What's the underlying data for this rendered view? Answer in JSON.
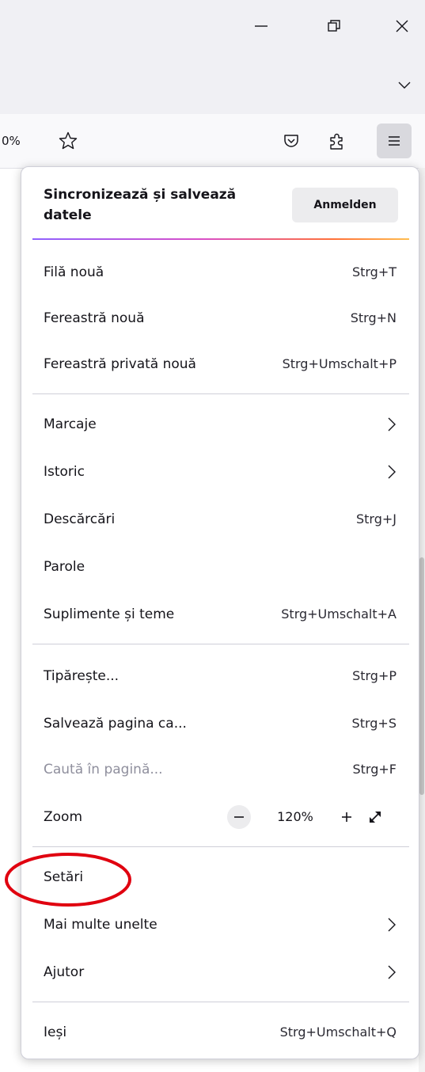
{
  "window": {
    "controls": {
      "minimize_icon": "minimize-icon",
      "restore_icon": "restore-icon",
      "close_icon": "close-icon"
    }
  },
  "tabstrip": {
    "list_tabs_icon": "chevron-down-icon"
  },
  "toolbar": {
    "url_fragment": "0%",
    "icons": [
      "star-icon",
      "pocket-icon",
      "extensions-icon",
      "hamburger-menu-icon"
    ]
  },
  "menu": {
    "sync": {
      "text": "Sincronizează și salvează datele",
      "signin_label": "Anmelden"
    },
    "group1": [
      {
        "label": "Filă nouă",
        "shortcut": "Strg+T"
      },
      {
        "label": "Fereastră nouă",
        "shortcut": "Strg+N"
      },
      {
        "label": "Fereastră privată nouă",
        "shortcut": "Strg+Umschalt+P"
      }
    ],
    "group2": [
      {
        "label": "Marcaje",
        "shortcut": ""
      },
      {
        "label": "Istoric",
        "shortcut": ""
      },
      {
        "label": "Descărcări",
        "shortcut": "Strg+J"
      },
      {
        "label": "Parole",
        "shortcut": ""
      },
      {
        "label": "Suplimente și teme",
        "shortcut": "Strg+Umschalt+A"
      }
    ],
    "group3": [
      {
        "label": "Tipărește...",
        "shortcut": "Strg+P"
      },
      {
        "label": "Salvează pagina ca...",
        "shortcut": "Strg+S"
      },
      {
        "label": "Caută în pagină...",
        "shortcut": "Strg+F"
      }
    ],
    "zoom": {
      "label": "Zoom",
      "minus": "−",
      "value": "120%",
      "plus": "+"
    },
    "group4": [
      {
        "label": "Setări"
      },
      {
        "label": "Mai multe unelte"
      },
      {
        "label": "Ajutor"
      }
    ],
    "quit": {
      "label": "Ieși",
      "shortcut": "Strg+Umschalt+Q"
    }
  },
  "colors": {
    "annotation": "#e0000f",
    "gradient": [
      "#8f61ff",
      "#d94fc8",
      "#ff7139",
      "#ffbd4f"
    ]
  }
}
